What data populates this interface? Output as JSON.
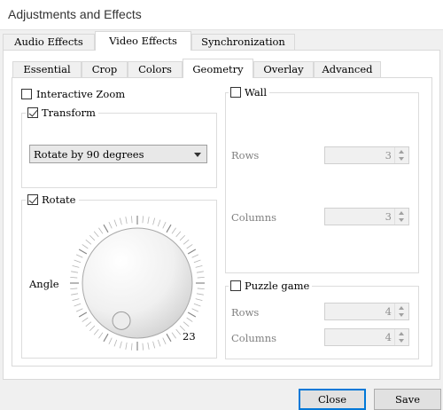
{
  "window": {
    "title": "Adjustments and Effects"
  },
  "main_tabs": [
    {
      "label": "Audio Effects"
    },
    {
      "label": "Video Effects"
    },
    {
      "label": "Synchronization"
    }
  ],
  "sub_tabs": [
    {
      "label": "Essential"
    },
    {
      "label": "Crop"
    },
    {
      "label": "Colors"
    },
    {
      "label": "Geometry"
    },
    {
      "label": "Overlay"
    },
    {
      "label": "Advanced"
    }
  ],
  "geometry": {
    "interactive_zoom": {
      "label": "Interactive Zoom",
      "checked": false
    },
    "transform": {
      "label": "Transform",
      "checked": true,
      "selected": "Rotate by 90 degrees"
    },
    "rotate": {
      "label": "Rotate",
      "checked": true,
      "angle_label": "Angle",
      "angle_value": "23"
    },
    "wall": {
      "label": "Wall",
      "checked": false,
      "rows_label": "Rows",
      "rows_value": "3",
      "columns_label": "Columns",
      "columns_value": "3"
    },
    "puzzle": {
      "label": "Puzzle game",
      "checked": false,
      "rows_label": "Rows",
      "rows_value": "4",
      "columns_label": "Columns",
      "columns_value": "4"
    }
  },
  "buttons": {
    "close": "Close",
    "save": "Save"
  },
  "colors": {
    "accent": "#0078d7",
    "disabled_text": "#808080"
  }
}
